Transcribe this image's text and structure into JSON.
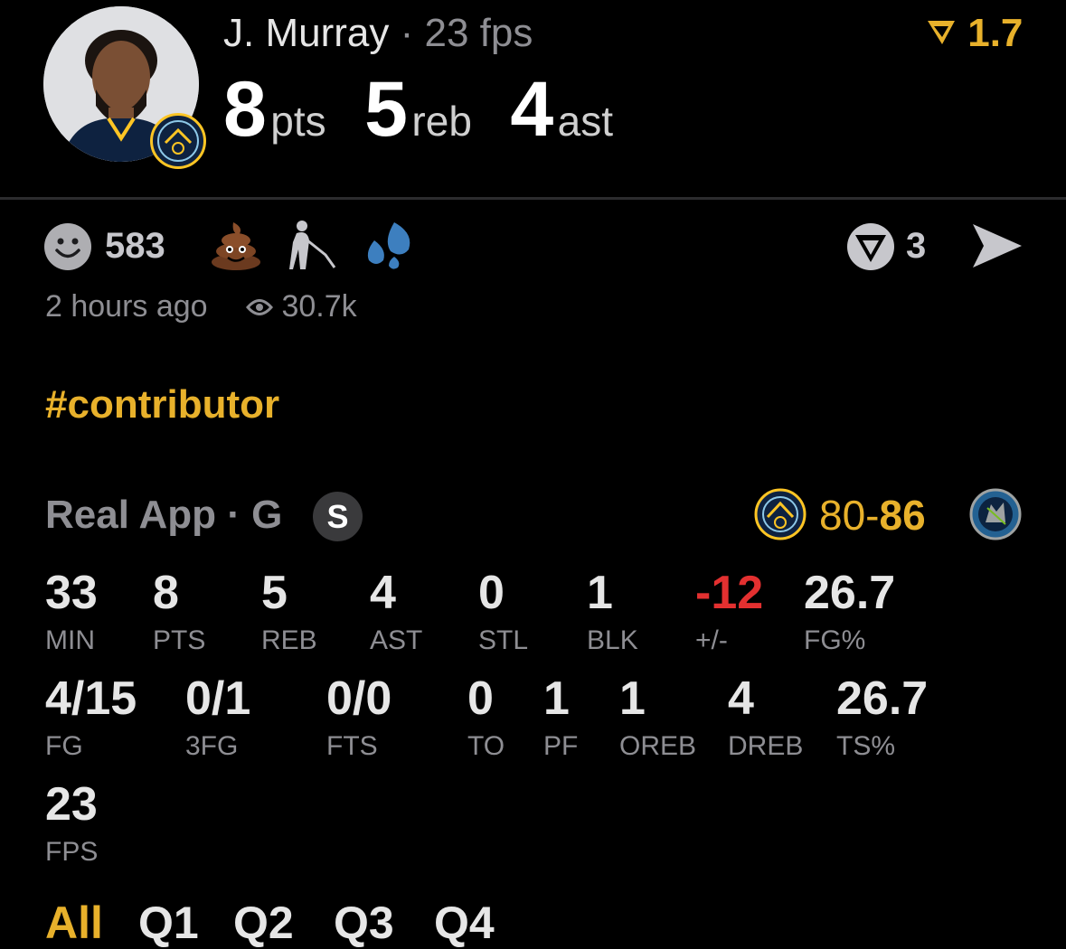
{
  "player": {
    "name": "J. Murray",
    "fps_inline": "· 23 fps",
    "pts": "8",
    "pts_unit": "pts",
    "reb": "5",
    "reb_unit": "reb",
    "ast": "4",
    "ast_unit": "ast"
  },
  "rating": {
    "value": "1.7",
    "icon": "v-rating-icon",
    "color": "#e8b12b"
  },
  "reactions": {
    "smile_count": "583",
    "emojis": [
      "poop-emoji",
      "old-man-cane-emoji",
      "sweat-droplets-emoji"
    ],
    "v_count": "3"
  },
  "meta": {
    "time": "2 hours ago",
    "views": "30.7k"
  },
  "hashtag": "#contributor",
  "game": {
    "source": "Real App · G",
    "badge": "S",
    "score_home": "80",
    "score_sep": "-",
    "score_away": "86"
  },
  "stats_row1": [
    {
      "value": "33",
      "label": "MIN"
    },
    {
      "value": "8",
      "label": "PTS"
    },
    {
      "value": "5",
      "label": "REB"
    },
    {
      "value": "4",
      "label": "AST"
    },
    {
      "value": "0",
      "label": "STL"
    },
    {
      "value": "1",
      "label": "BLK"
    },
    {
      "value": "-12",
      "label": "+/-"
    },
    {
      "value": "26.7",
      "label": "FG%"
    }
  ],
  "stats_row2": [
    {
      "value": "4/15",
      "label": "FG"
    },
    {
      "value": "0/1",
      "label": "3FG"
    },
    {
      "value": "0/0",
      "label": "FTS"
    },
    {
      "value": "0",
      "label": "TO"
    },
    {
      "value": "1",
      "label": "PF"
    },
    {
      "value": "1",
      "label": "OREB"
    },
    {
      "value": "4",
      "label": "DREB"
    },
    {
      "value": "26.7",
      "label": "TS%"
    }
  ],
  "stats_row3": [
    {
      "value": "23",
      "label": "FPS"
    }
  ],
  "tabs": [
    {
      "label": "All",
      "active": true
    },
    {
      "label": "Q1"
    },
    {
      "label": "Q2"
    },
    {
      "label": "Q3"
    },
    {
      "label": "Q4"
    }
  ],
  "colors": {
    "accent": "#e8b12b",
    "negative": "#e33030",
    "muted": "#8e8e93"
  }
}
